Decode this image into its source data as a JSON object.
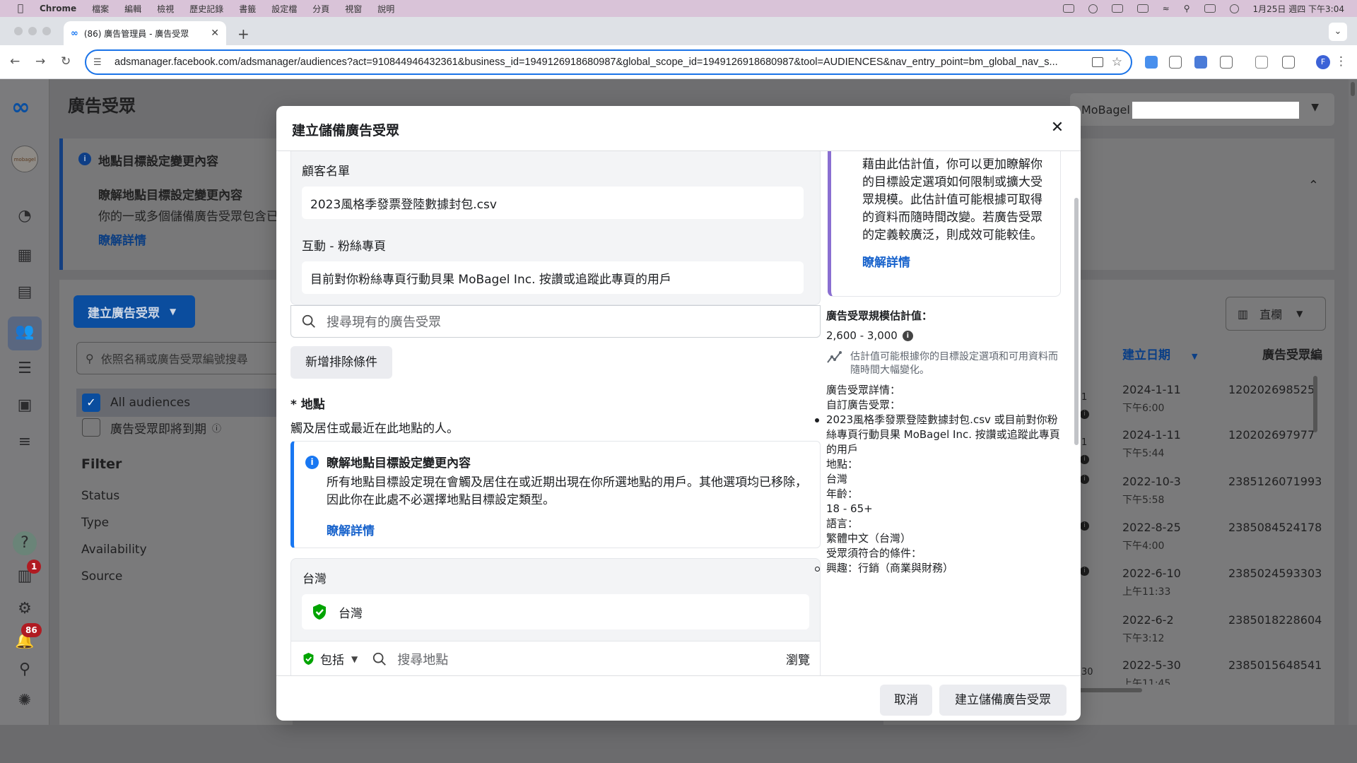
{
  "menubar": {
    "app": "Chrome",
    "items": [
      "檔案",
      "編輯",
      "檢視",
      "歷史記錄",
      "書籤",
      "設定檔",
      "分頁",
      "視窗",
      "說明"
    ],
    "clock": "1月25日 週四 下午3:04"
  },
  "browser": {
    "tab_title": "(86) 廣告管理員 - 廣告受眾",
    "url": "adsmanager.facebook.com/adsmanager/audiences?act=910844946432361&business_id=1949126918680987&global_scope_id=1949126918680987&tool=AUDIENCES&nav_entry_point=bm_global_nav_s...",
    "profile_initial": "F"
  },
  "background": {
    "page_title": "廣告受眾",
    "notice": {
      "title": "地點目標設定變更內容",
      "subtitle": "瞭解地點目標設定變更內容",
      "body": "你的一或多個儲備廣告受眾包含已",
      "link": "瞭解詳情"
    },
    "create_button": "建立廣告受眾",
    "search_placeholder": "依照名稱或廣告受眾編號搜尋",
    "all_audiences": "All audiences",
    "expiring": "廣告受眾即將到期",
    "filter_title": "Filter",
    "filter_items": [
      "Status",
      "Type",
      "Availability",
      "Source"
    ],
    "account_name": "MoBagel",
    "columns_button": "直欄",
    "col_created": "建立日期",
    "col_id": "廣告受眾編",
    "rows": [
      {
        "date": "2024-1-11",
        "time": "下午6:00",
        "id": "120202698525"
      },
      {
        "date": "2024-1-11",
        "time": "下午5:44",
        "id": "120202697977"
      },
      {
        "date": "2022-10-3",
        "time": "下午5:58",
        "id": "2385126071993"
      },
      {
        "date": "2022-8-25",
        "time": "下午4:00",
        "id": "2385084524178"
      },
      {
        "date": "2022-6-10",
        "time": "上午11:33",
        "id": "2385024593303"
      },
      {
        "date": "2022-6-2",
        "time": "下午3:12",
        "id": "2385018228604"
      },
      {
        "date": "2022-5-30",
        "time": "上午11:45",
        "id": "2385015648541"
      }
    ],
    "badges": {
      "notifications": "86",
      "alerts": "1"
    },
    "row_fragment_1": "1",
    "row_fragment_7": "30"
  },
  "modal": {
    "title": "建立儲備廣告受眾",
    "customer_list_label": "顧客名單",
    "customer_list_value": "2023風格季發票登陸數據封包.csv",
    "engagement_label": "互動 - 粉絲專頁",
    "engagement_value": "目前對你粉絲專頁行動貝果 MoBagel Inc. 按讚或追蹤此專頁的用戶",
    "search_audience_placeholder": "搜尋現有的廣告受眾",
    "exclude_button": "新增排除條件",
    "location_title": "* 地點",
    "location_subtitle": "觸及居住或最近在此地點的人。",
    "info": {
      "title": "瞭解地點目標設定變更內容",
      "body": "所有地點目標設定現在會觸及居住在或近期出現在你所選地點的用戶。其他選項均已移除，因此你在此處不必選擇地點目標設定類型。",
      "link": "瞭解詳情"
    },
    "location_group": "台灣",
    "location_chip": "台灣",
    "include_label": "包括",
    "search_location_placeholder": "搜尋地點",
    "browse": "瀏覽",
    "estimate_card_text": "藉由此估計值，你可以更加瞭解你的目標設定選項如何限制或擴大受眾規模。此估計值可能根據可取得的資料而隨時間改變。若廣告受眾的定義較廣泛，則成效可能較佳。",
    "estimate_card_link": "瞭解詳情",
    "estimate_label": "廣告受眾規模估計值：",
    "estimate_range": "2,600 - 3,000",
    "estimate_note": "估計值可能根據你的目標設定選項和可用資料而隨時間大幅變化。",
    "details": {
      "title": "廣告受眾詳情：",
      "custom_label": "自訂廣告受眾：",
      "custom_value": "2023風格季發票登陸數據封包.csv 或目前對你粉絲專頁行動貝果 MoBagel Inc. 按讚或追蹤此專頁的用戶",
      "location_label": "地點：",
      "location_value": "台灣",
      "age_label": "年齡：",
      "age_value": "18 - 65+",
      "language_label": "語言：",
      "language_value": "繁體中文（台灣）",
      "criteria_label": "受眾須符合的條件：",
      "criteria_value": "興趣：行銷（商業與財務）"
    },
    "cancel_button": "取消",
    "create_button": "建立儲備廣告受眾"
  },
  "colors": {
    "facebook_blue": "#1877f2",
    "link_blue": "#1863cc",
    "estimate_accent": "#8a6fd1",
    "success_green": "#00a400"
  }
}
